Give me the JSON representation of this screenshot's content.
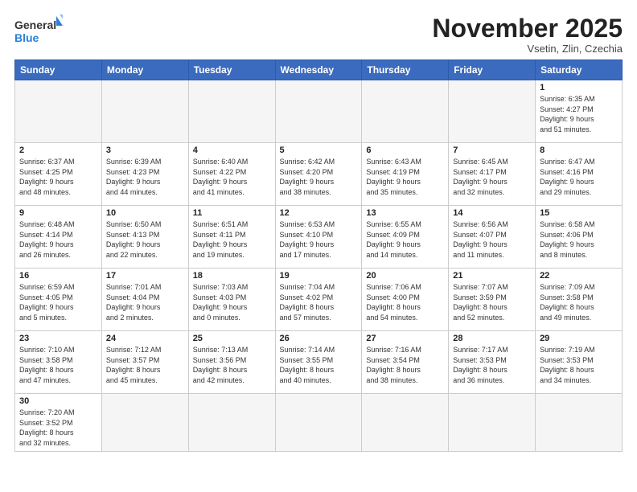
{
  "header": {
    "logo_general": "General",
    "logo_blue": "Blue",
    "month_title": "November 2025",
    "subtitle": "Vsetin, Zlin, Czechia"
  },
  "weekdays": [
    "Sunday",
    "Monday",
    "Tuesday",
    "Wednesday",
    "Thursday",
    "Friday",
    "Saturday"
  ],
  "weeks": [
    [
      {
        "day": "",
        "info": ""
      },
      {
        "day": "",
        "info": ""
      },
      {
        "day": "",
        "info": ""
      },
      {
        "day": "",
        "info": ""
      },
      {
        "day": "",
        "info": ""
      },
      {
        "day": "",
        "info": ""
      },
      {
        "day": "1",
        "info": "Sunrise: 6:35 AM\nSunset: 4:27 PM\nDaylight: 9 hours\nand 51 minutes."
      }
    ],
    [
      {
        "day": "2",
        "info": "Sunrise: 6:37 AM\nSunset: 4:25 PM\nDaylight: 9 hours\nand 48 minutes."
      },
      {
        "day": "3",
        "info": "Sunrise: 6:39 AM\nSunset: 4:23 PM\nDaylight: 9 hours\nand 44 minutes."
      },
      {
        "day": "4",
        "info": "Sunrise: 6:40 AM\nSunset: 4:22 PM\nDaylight: 9 hours\nand 41 minutes."
      },
      {
        "day": "5",
        "info": "Sunrise: 6:42 AM\nSunset: 4:20 PM\nDaylight: 9 hours\nand 38 minutes."
      },
      {
        "day": "6",
        "info": "Sunrise: 6:43 AM\nSunset: 4:19 PM\nDaylight: 9 hours\nand 35 minutes."
      },
      {
        "day": "7",
        "info": "Sunrise: 6:45 AM\nSunset: 4:17 PM\nDaylight: 9 hours\nand 32 minutes."
      },
      {
        "day": "8",
        "info": "Sunrise: 6:47 AM\nSunset: 4:16 PM\nDaylight: 9 hours\nand 29 minutes."
      }
    ],
    [
      {
        "day": "9",
        "info": "Sunrise: 6:48 AM\nSunset: 4:14 PM\nDaylight: 9 hours\nand 26 minutes."
      },
      {
        "day": "10",
        "info": "Sunrise: 6:50 AM\nSunset: 4:13 PM\nDaylight: 9 hours\nand 22 minutes."
      },
      {
        "day": "11",
        "info": "Sunrise: 6:51 AM\nSunset: 4:11 PM\nDaylight: 9 hours\nand 19 minutes."
      },
      {
        "day": "12",
        "info": "Sunrise: 6:53 AM\nSunset: 4:10 PM\nDaylight: 9 hours\nand 17 minutes."
      },
      {
        "day": "13",
        "info": "Sunrise: 6:55 AM\nSunset: 4:09 PM\nDaylight: 9 hours\nand 14 minutes."
      },
      {
        "day": "14",
        "info": "Sunrise: 6:56 AM\nSunset: 4:07 PM\nDaylight: 9 hours\nand 11 minutes."
      },
      {
        "day": "15",
        "info": "Sunrise: 6:58 AM\nSunset: 4:06 PM\nDaylight: 9 hours\nand 8 minutes."
      }
    ],
    [
      {
        "day": "16",
        "info": "Sunrise: 6:59 AM\nSunset: 4:05 PM\nDaylight: 9 hours\nand 5 minutes."
      },
      {
        "day": "17",
        "info": "Sunrise: 7:01 AM\nSunset: 4:04 PM\nDaylight: 9 hours\nand 2 minutes."
      },
      {
        "day": "18",
        "info": "Sunrise: 7:03 AM\nSunset: 4:03 PM\nDaylight: 9 hours\nand 0 minutes."
      },
      {
        "day": "19",
        "info": "Sunrise: 7:04 AM\nSunset: 4:02 PM\nDaylight: 8 hours\nand 57 minutes."
      },
      {
        "day": "20",
        "info": "Sunrise: 7:06 AM\nSunset: 4:00 PM\nDaylight: 8 hours\nand 54 minutes."
      },
      {
        "day": "21",
        "info": "Sunrise: 7:07 AM\nSunset: 3:59 PM\nDaylight: 8 hours\nand 52 minutes."
      },
      {
        "day": "22",
        "info": "Sunrise: 7:09 AM\nSunset: 3:58 PM\nDaylight: 8 hours\nand 49 minutes."
      }
    ],
    [
      {
        "day": "23",
        "info": "Sunrise: 7:10 AM\nSunset: 3:58 PM\nDaylight: 8 hours\nand 47 minutes."
      },
      {
        "day": "24",
        "info": "Sunrise: 7:12 AM\nSunset: 3:57 PM\nDaylight: 8 hours\nand 45 minutes."
      },
      {
        "day": "25",
        "info": "Sunrise: 7:13 AM\nSunset: 3:56 PM\nDaylight: 8 hours\nand 42 minutes."
      },
      {
        "day": "26",
        "info": "Sunrise: 7:14 AM\nSunset: 3:55 PM\nDaylight: 8 hours\nand 40 minutes."
      },
      {
        "day": "27",
        "info": "Sunrise: 7:16 AM\nSunset: 3:54 PM\nDaylight: 8 hours\nand 38 minutes."
      },
      {
        "day": "28",
        "info": "Sunrise: 7:17 AM\nSunset: 3:53 PM\nDaylight: 8 hours\nand 36 minutes."
      },
      {
        "day": "29",
        "info": "Sunrise: 7:19 AM\nSunset: 3:53 PM\nDaylight: 8 hours\nand 34 minutes."
      }
    ],
    [
      {
        "day": "30",
        "info": "Sunrise: 7:20 AM\nSunset: 3:52 PM\nDaylight: 8 hours\nand 32 minutes."
      },
      {
        "day": "",
        "info": ""
      },
      {
        "day": "",
        "info": ""
      },
      {
        "day": "",
        "info": ""
      },
      {
        "day": "",
        "info": ""
      },
      {
        "day": "",
        "info": ""
      },
      {
        "day": "",
        "info": ""
      }
    ]
  ]
}
